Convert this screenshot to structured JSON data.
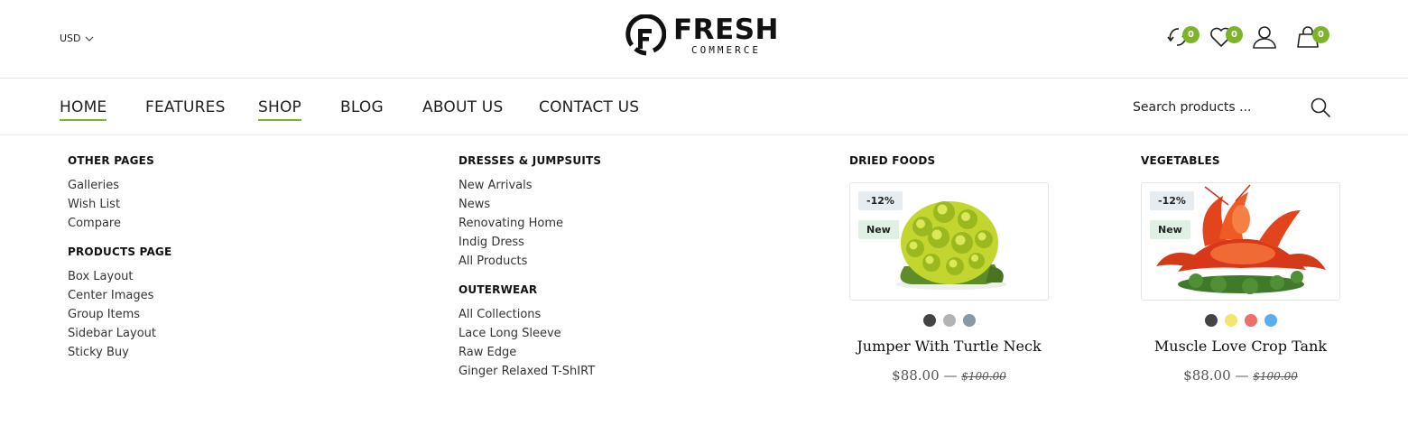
{
  "topbar": {
    "currency": "USD",
    "logo": {
      "word": "FRESH",
      "sub": "COMMERCE"
    },
    "icons": [
      {
        "name": "compare-icon",
        "count": "0"
      },
      {
        "name": "wishlist-icon",
        "count": "0"
      },
      {
        "name": "account-icon",
        "count": ""
      },
      {
        "name": "cart-icon",
        "count": "0"
      }
    ]
  },
  "nav": {
    "items": [
      "HOME",
      "FEATURES",
      "SHOP",
      "BLOG",
      "ABOUT US",
      "CONTACT US"
    ],
    "search_placeholder": "Search products ..."
  },
  "mega": {
    "col1": {
      "group1_title": "OTHER PAGES",
      "group1": [
        "Galleries",
        "Wish List",
        "Compare"
      ],
      "group2_title": "PRODUCTS PAGE",
      "group2": [
        "Box Layout",
        "Center Images",
        "Group Items",
        "Sidebar Layout",
        "Sticky Buy"
      ]
    },
    "col2": {
      "group1_title": "DRESSES & JUMPSUITS",
      "group1": [
        "New Arrivals",
        "News",
        "Renovating Home",
        "Indig Dress",
        "All Products"
      ],
      "group2_title": "OUTERWEAR",
      "group2": [
        "All Collections",
        "Lace Long Sleeve",
        "Raw Edge",
        "Ginger Relaxed T-ShIRT"
      ]
    },
    "products": [
      {
        "category": "DRIED FOODS",
        "sale_tag": "-12%",
        "new_tag": "New",
        "swatches": [
          "#444444",
          "#b3b3b3",
          "#8899a6"
        ],
        "name": "Jumper With Turtle Neck",
        "price": "$88.00",
        "separator": "—",
        "old_price": "$100.00",
        "image": "romanesco-broccoli"
      },
      {
        "category": "VEGETABLES",
        "sale_tag": "-12%",
        "new_tag": "New",
        "swatches": [
          "#444444",
          "#f3e56d",
          "#ee6e6a",
          "#5aaef0"
        ],
        "name": "Muscle Love Crop Tank",
        "price": "$88.00",
        "separator": "—",
        "old_price": "$100.00",
        "image": "crayfish-on-dill"
      }
    ]
  },
  "colors": {
    "accent": "#7cb32a"
  }
}
